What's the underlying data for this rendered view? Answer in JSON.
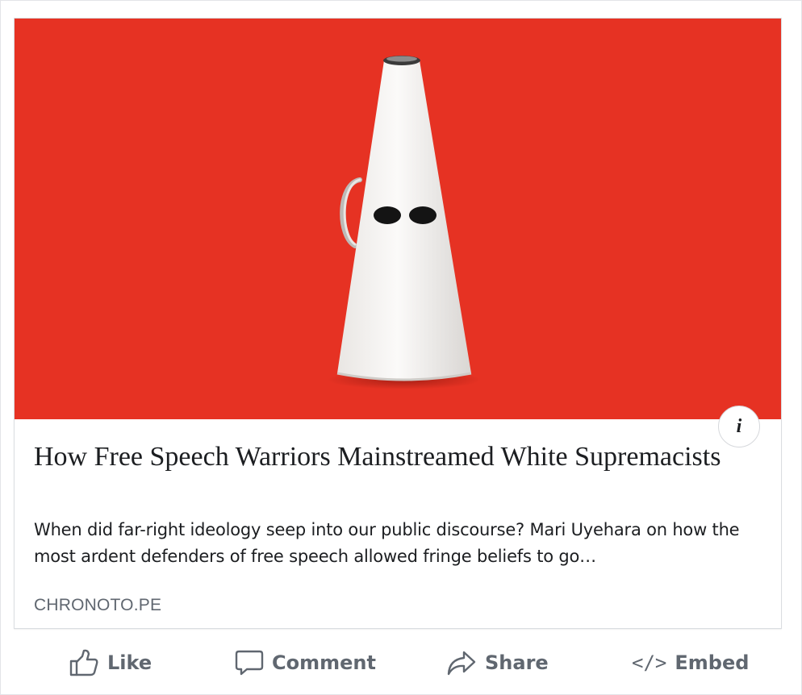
{
  "card": {
    "title": "How Free Speech Warriors Mainstreamed White Supremacists",
    "description": "When did far-right ideology seep into our public discourse? Mari Uyehara on how the most ardent defenders of free speech allowed fringe beliefs to go…",
    "domain": "CHRONOTO.PE",
    "info_symbol": "i",
    "image": {
      "background_color": "#e63223",
      "subject": "white megaphone shaped like a hood"
    }
  },
  "actions": {
    "like": "Like",
    "comment": "Comment",
    "share": "Share",
    "embed": "Embed",
    "embed_glyph": "</>"
  },
  "icons": {
    "like": "thumbs-up-icon",
    "comment": "speech-bubble-icon",
    "share": "share-arrow-icon",
    "embed": "code-brackets-icon",
    "info": "info-icon"
  }
}
